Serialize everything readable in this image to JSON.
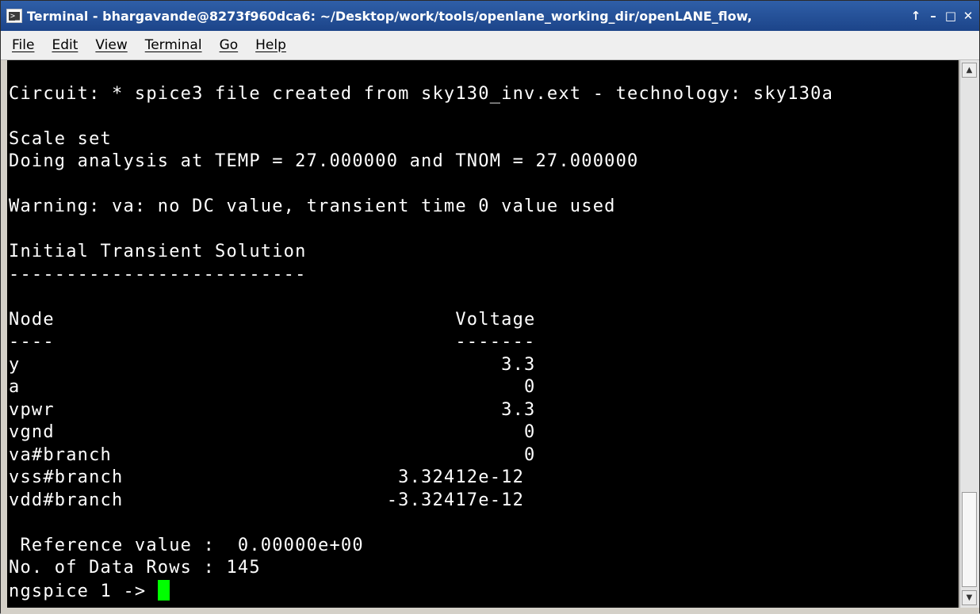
{
  "window": {
    "title": "Terminal - bhargavande@8273f960dca6: ~/Desktop/work/tools/openlane_working_dir/openLANE_flow,",
    "controls": {
      "pin": "↑",
      "minimize": "–",
      "maximize": "□",
      "close": "✕"
    },
    "icon": "terminal-icon"
  },
  "menu": {
    "file": "File",
    "edit": "Edit",
    "view": "View",
    "terminal": "Terminal",
    "go": "Go",
    "help": "Help"
  },
  "terminal": {
    "lines": [
      "",
      "Circuit: * spice3 file created from sky130_inv.ext - technology: sky130a",
      "",
      "Scale set",
      "Doing analysis at TEMP = 27.000000 and TNOM = 27.000000",
      "",
      "Warning: va: no DC value, transient time 0 value used",
      "",
      "Initial Transient Solution",
      "--------------------------",
      "",
      "Node                                   Voltage",
      "----                                   -------",
      "y                                          3.3",
      "a                                            0",
      "vpwr                                       3.3",
      "vgnd                                         0",
      "va#branch                                    0",
      "vss#branch                        3.32412e-12",
      "vdd#branch                       -3.32417e-12",
      "",
      " Reference value :  0.00000e+00",
      "No. of Data Rows : 145"
    ],
    "prompt": "ngspice 1 -> ",
    "cursor_color": "#00ff00",
    "background": "#000000",
    "foreground": "#ffffff"
  },
  "colors": {
    "titlebar": "#1c4489",
    "menubar": "#efefef"
  }
}
